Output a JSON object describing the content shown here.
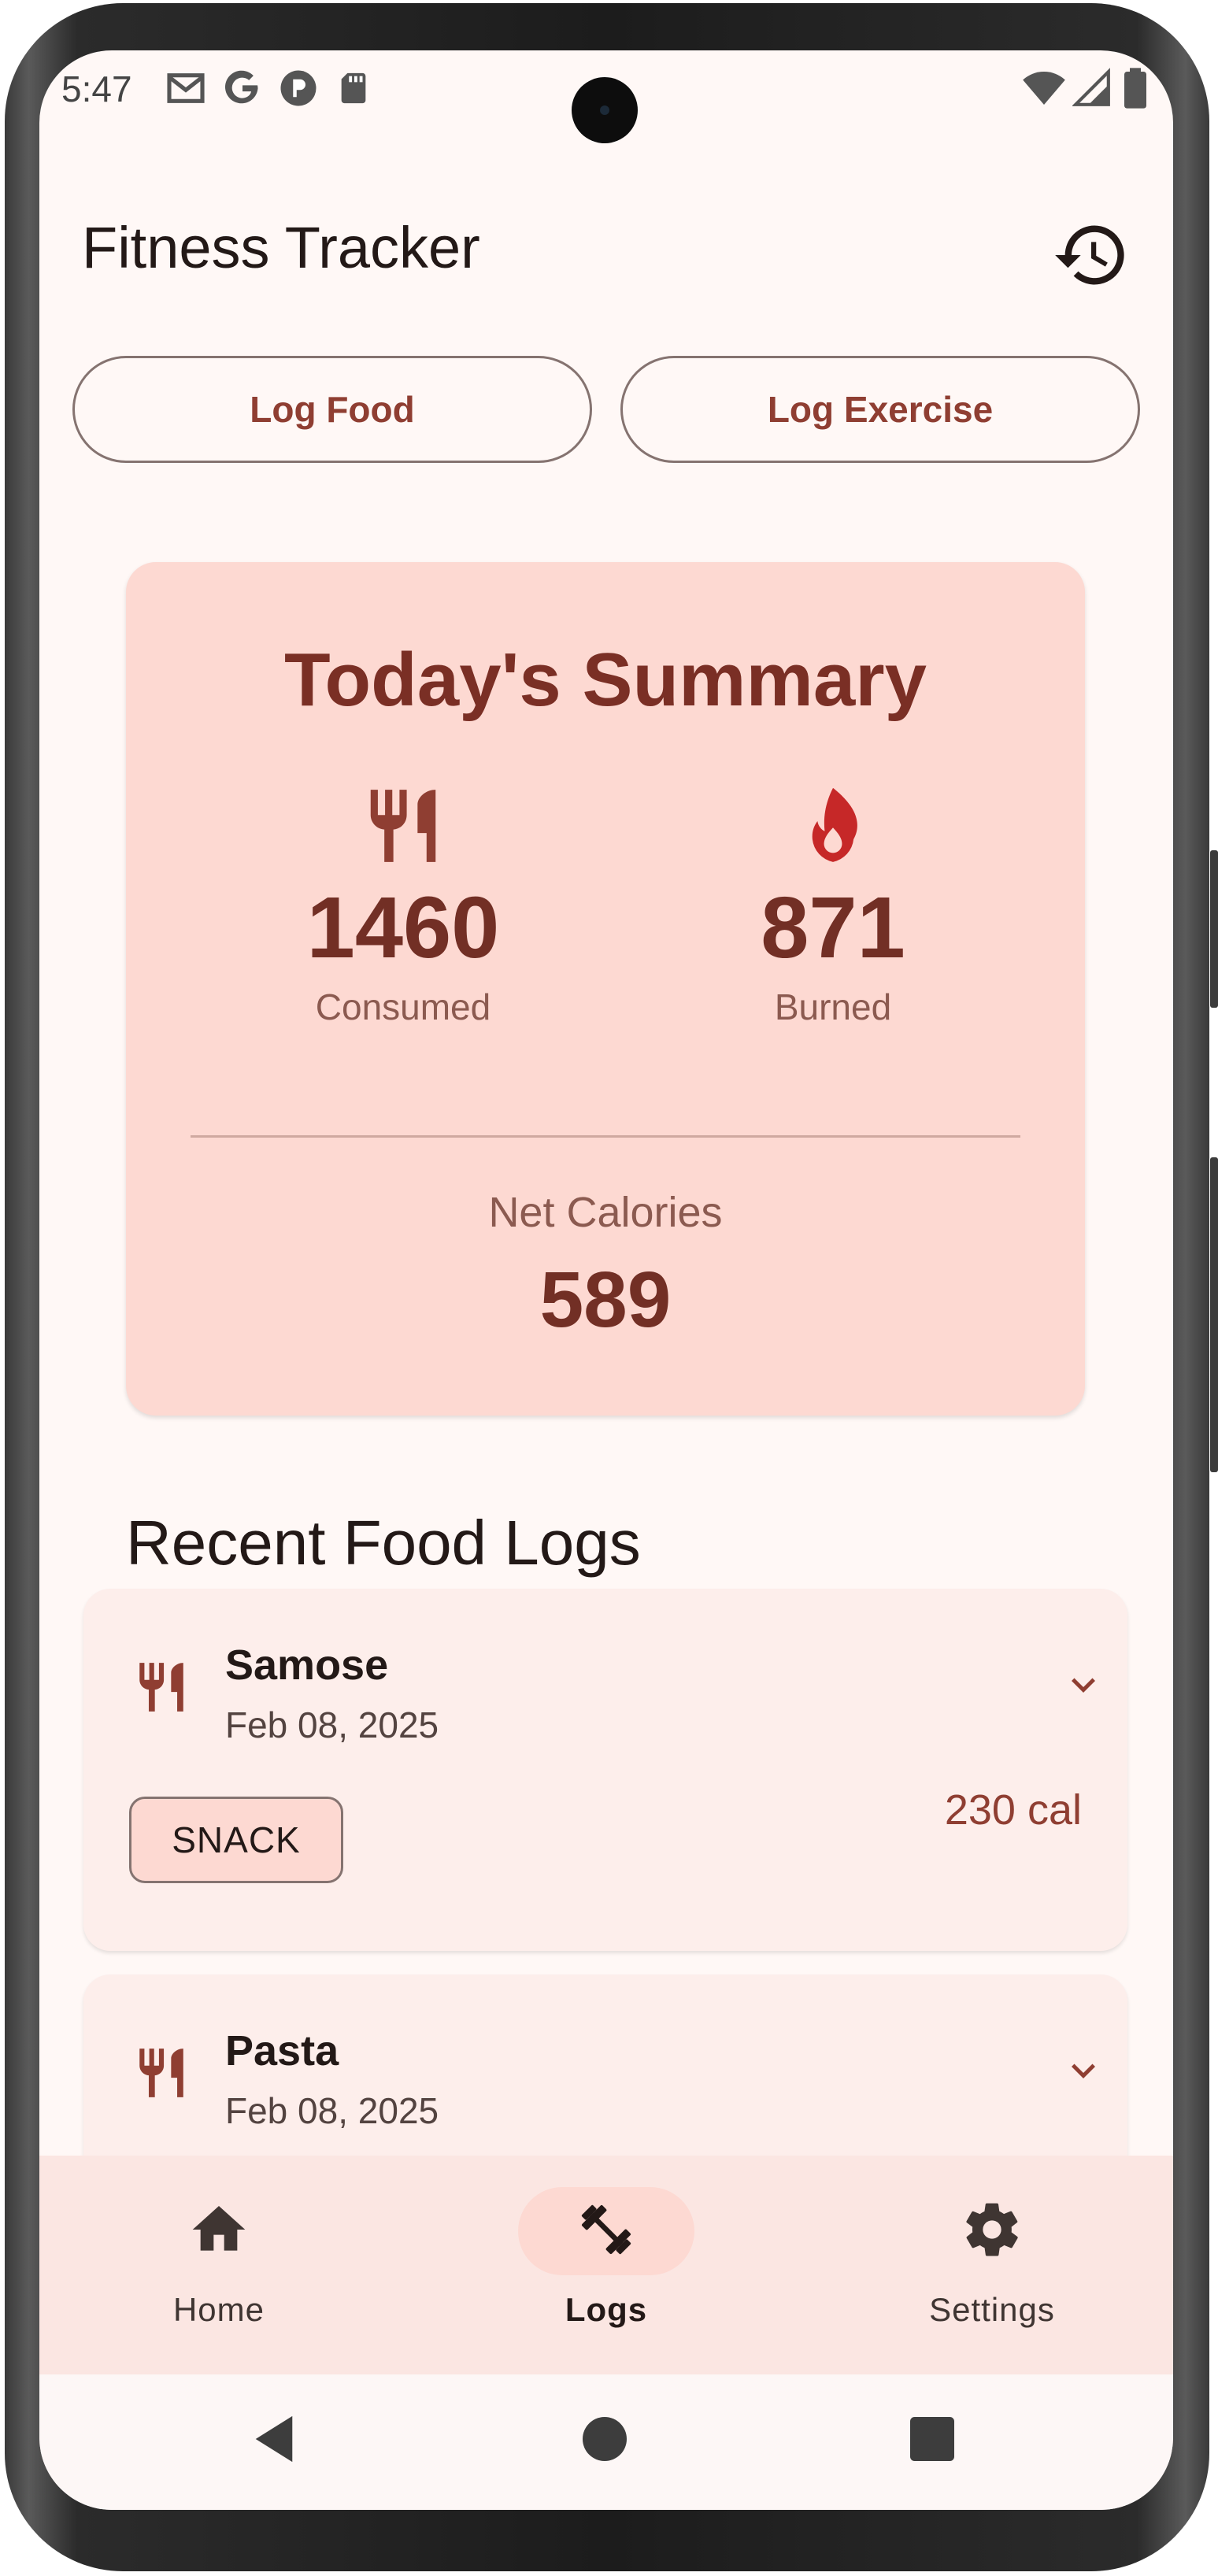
{
  "status_bar": {
    "time": "5:47",
    "left_icons": [
      "gmail-icon",
      "google-icon",
      "app-icon",
      "sd-card-icon"
    ],
    "right_icons": [
      "wifi-icon",
      "signal-icon",
      "battery-icon"
    ]
  },
  "app_bar": {
    "title": "Fitness Tracker",
    "history_icon": "history-icon"
  },
  "actions": {
    "log_food": "Log Food",
    "log_exercise": "Log Exercise"
  },
  "summary": {
    "title": "Today's Summary",
    "consumed_value": "1460",
    "consumed_label": "Consumed",
    "burned_value": "871",
    "burned_label": "Burned",
    "net_label": "Net Calories",
    "net_value": "589"
  },
  "recent": {
    "title": "Recent Food Logs",
    "items": [
      {
        "name": "Samose",
        "date": "Feb 08, 2025",
        "category": "SNACK",
        "calories": "230 cal"
      },
      {
        "name": "Pasta",
        "date": "Feb 08, 2025"
      }
    ]
  },
  "bottom_nav": {
    "items": [
      {
        "label": "Home",
        "icon": "home-icon"
      },
      {
        "label": "Logs",
        "icon": "dumbbell-icon",
        "selected": true
      },
      {
        "label": "Settings",
        "icon": "gear-icon"
      }
    ]
  },
  "colors": {
    "background": "#fff8f6",
    "primary": "#8f3e32",
    "card": "#fdd9d2",
    "burn_icon": "#c62828"
  }
}
